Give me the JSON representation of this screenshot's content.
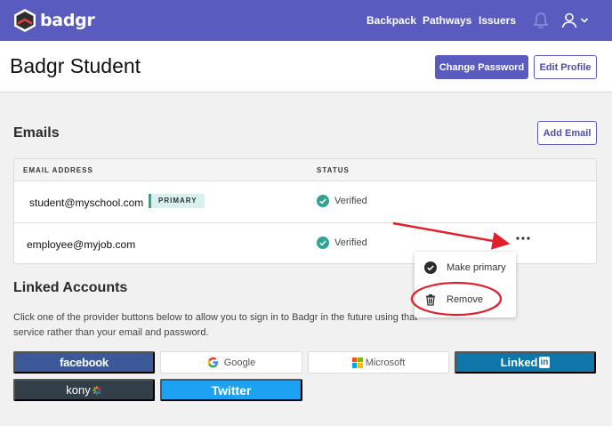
{
  "app": {
    "name": "badgr"
  },
  "nav": {
    "backpack": "Backpack",
    "pathways": "Pathways",
    "issuers": "Issuers"
  },
  "header": {
    "title": "Badgr Student",
    "change_password": "Change Password",
    "edit_profile": "Edit Profile"
  },
  "emails": {
    "title": "Emails",
    "add_email": "Add Email",
    "columns": {
      "email": "EMAIL ADDRESS",
      "status": "STATUS"
    },
    "rows": [
      {
        "email": "student@myschool.com",
        "badge": "PRIMARY",
        "status": "Verified"
      },
      {
        "email": "employee@myjob.com",
        "status": "Verified"
      }
    ]
  },
  "menu": {
    "make_primary": "Make primary",
    "remove": "Remove"
  },
  "linked": {
    "title": "Linked Accounts",
    "description": "Click one of the provider buttons below to allow you to sign in to Badgr in the future using that service rather than your email and password.",
    "providers": {
      "facebook": "facebook",
      "google": "Google",
      "microsoft": "Microsoft",
      "linkedin": "Linked",
      "linkedin_in": "in",
      "kony": "kony",
      "twitter": "Twitter"
    }
  },
  "colors": {
    "brand": "#5a5bbf",
    "verified": "#2fa48e",
    "annotation": "#e0202a",
    "facebook": "#3b5998",
    "linkedin": "#0e76a8",
    "kony": "#333f48",
    "twitter": "#1da1f2"
  },
  "icons": [
    "logo-icon",
    "bell-icon",
    "user-icon",
    "chevron-down-icon",
    "check-circle-icon",
    "more-icon",
    "trash-icon",
    "google-icon",
    "microsoft-icon"
  ]
}
